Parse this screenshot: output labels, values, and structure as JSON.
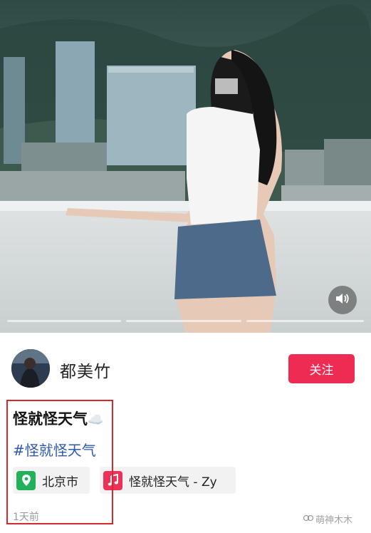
{
  "post": {
    "username": "都美竹",
    "follow_label": "关注",
    "title": "怪就怪天气",
    "title_emoji": "☁️",
    "hashtag": "#怪就怪天气",
    "location": "北京市",
    "music": "怪就怪天气 - Zy",
    "time": "1天前"
  },
  "watermark": {
    "text": "萌神木木"
  },
  "colors": {
    "follow_button": "#ee2b53",
    "hashtag": "#2d5aa8",
    "location_icon": "#22b15a",
    "music_icon": "#ee3158",
    "highlight_border": "#d42a2a"
  },
  "icons": {
    "sound": "speaker-icon",
    "location": "location-pin-icon",
    "music": "music-note-icon"
  },
  "media": {
    "segments_total": 3
  }
}
